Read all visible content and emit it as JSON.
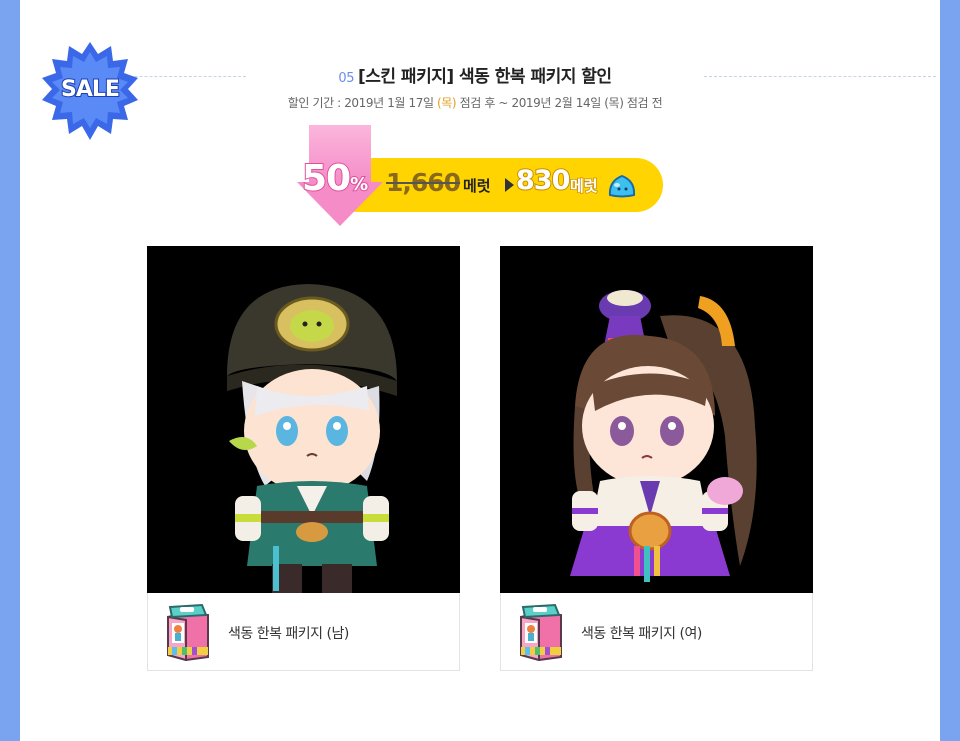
{
  "badge": {
    "label": "SALE"
  },
  "header": {
    "number": "05",
    "title": "[스킨 패키지] 색동 한복 패키지 할인",
    "period_prefix": "할인 기간 : 2019년 1월 17일 ",
    "period_highlight": "(목)",
    "period_suffix": " 점검 후 ~ 2019년 2월 14일 (목) 점검 전"
  },
  "price": {
    "discount_number": "50",
    "discount_symbol": "%",
    "original_value": "1,660",
    "original_unit": "메럿",
    "sale_value": "830",
    "sale_unit": "메럿",
    "currency_icon": "meret-slime-icon"
  },
  "items": [
    {
      "name": "색동 한복 패키지 (남)",
      "icon": "package-bag-icon"
    },
    {
      "name": "색동 한복 패키지 (여)",
      "icon": "package-bag-icon"
    }
  ],
  "colors": {
    "page_background": "#7aa4f0",
    "badge_blue": "#3a68e8",
    "pill_yellow": "#ffd400",
    "arrow_pink": "#f58cc8",
    "number_accent": "#6a8ee8"
  }
}
